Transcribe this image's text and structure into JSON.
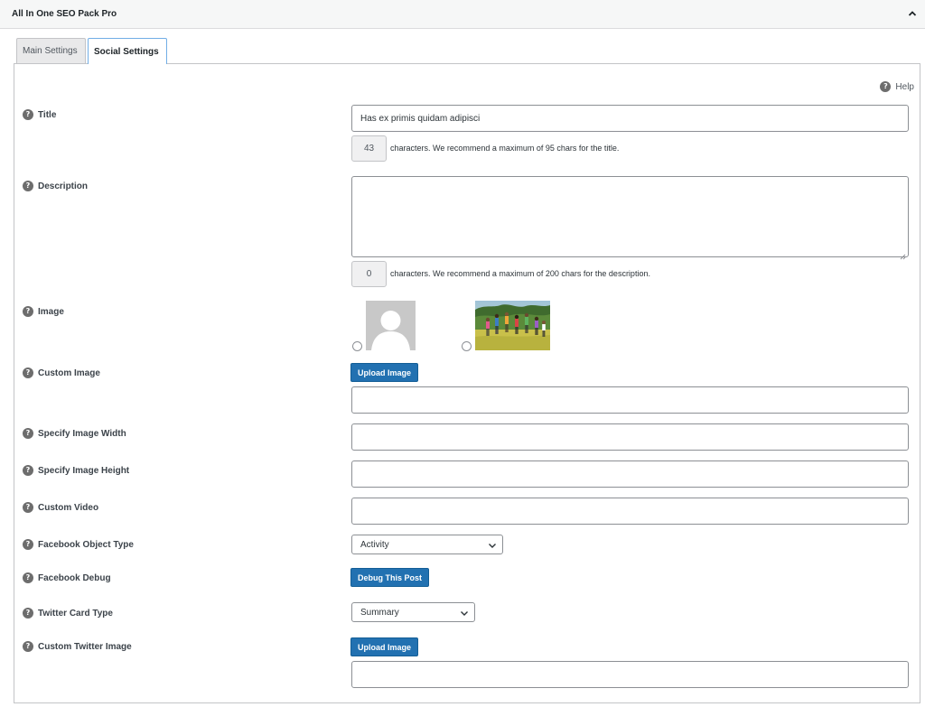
{
  "metabox": {
    "title": "All In One SEO Pack Pro"
  },
  "tabs": [
    {
      "label": "Main Settings"
    },
    {
      "label": "Social Settings"
    }
  ],
  "help": {
    "label": "Help"
  },
  "fields": {
    "title": {
      "label": "Title",
      "value": "Has ex primis quidam adipisci",
      "count": "43",
      "hint": "characters. We recommend a maximum of 95 chars for the title."
    },
    "description": {
      "label": "Description",
      "value": "",
      "count": "0",
      "hint": "characters. We recommend a maximum of 200 chars for the description."
    },
    "image": {
      "label": "Image"
    },
    "custom_image": {
      "label": "Custom Image",
      "button": "Upload Image",
      "value": ""
    },
    "image_width": {
      "label": "Specify Image Width",
      "value": ""
    },
    "image_height": {
      "label": "Specify Image Height",
      "value": ""
    },
    "custom_video": {
      "label": "Custom Video",
      "value": ""
    },
    "fb_object_type": {
      "label": "Facebook Object Type",
      "selected": "Activity"
    },
    "fb_debug": {
      "label": "Facebook Debug",
      "button": "Debug This Post"
    },
    "twitter_card": {
      "label": "Twitter Card Type",
      "selected": "Summary"
    },
    "custom_twitter_image": {
      "label": "Custom Twitter Image",
      "button": "Upload Image",
      "value": ""
    }
  },
  "icons": {
    "help": "question-circle-icon",
    "collapse": "chevron-up-icon",
    "select": "chevron-down-icon"
  },
  "colors": {
    "primary_button": "#2271b1",
    "focus_border": "#72aee6"
  }
}
